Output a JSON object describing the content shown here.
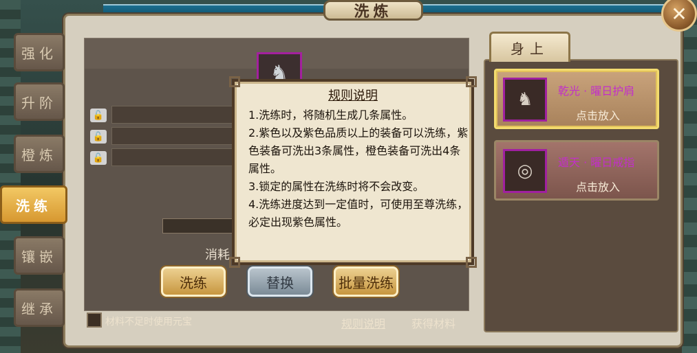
{
  "window": {
    "title": "洗炼",
    "close_icon": "✕"
  },
  "side_tabs": [
    {
      "label": "强化",
      "active": false
    },
    {
      "label": "升阶",
      "active": false
    },
    {
      "label": "橙炼",
      "active": false
    },
    {
      "label": "洗练",
      "active": true
    },
    {
      "label": "镶嵌",
      "active": false
    },
    {
      "label": "继承",
      "active": false
    }
  ],
  "main": {
    "consume_label": "消耗",
    "buttons": {
      "wash": "洗练",
      "replace": "替换",
      "batch_wash": "批量洗练"
    },
    "checkbox_label": "材料不足时使用元宝",
    "links": {
      "rules": "规则说明",
      "get_materials": "获得材料"
    }
  },
  "right": {
    "tab_label": "身上",
    "items": [
      {
        "name": "乾光 · 曜日护肩",
        "action": "点击放入",
        "selected": true
      },
      {
        "name": "遁天 · 曜日戒指",
        "action": "点击放入",
        "selected": false
      }
    ]
  },
  "dialog": {
    "title": "规则说明",
    "lines": [
      "1.洗练时，将随机生成几条属性。",
      "2.紫色以及紫色品质以上的装备可以洗练，紫色装备可洗出3条属性，橙色装备可洗出4条属性。",
      "3.锁定的属性在洗练时将不会改变。",
      "4.洗练进度达到一定值时，可使用至尊洗练，必定出现紫色属性。"
    ]
  }
}
